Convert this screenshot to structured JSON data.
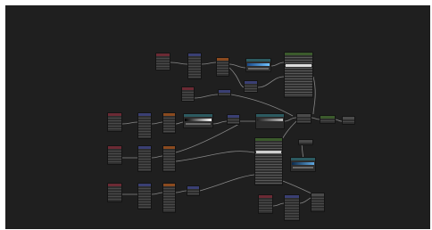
{
  "app": {
    "title": "",
    "description_visible": false
  },
  "colors": {
    "editor_bg": "#1f1f1f",
    "node_body": "#2e2e2e",
    "wire": "#9a9a9a",
    "header_red": "#6b2a34",
    "header_blue": "#3a3f73",
    "header_orange": "#8a4a1f",
    "header_teal": "#2c5a60",
    "header_green": "#3b5a2c",
    "header_gray": "#4a4a4a",
    "accent_blue": "#3b8fd6"
  },
  "nodes": [
    {
      "id": "n1",
      "header": "header_red"
    },
    {
      "id": "n2",
      "header": "header_blue"
    },
    {
      "id": "n3",
      "header": "header_orange"
    },
    {
      "id": "n4",
      "header": "header_teal"
    },
    {
      "id": "n5",
      "header": "header_blue"
    },
    {
      "id": "n6",
      "header": "header_green"
    },
    {
      "id": "n7",
      "header": "header_red"
    },
    {
      "id": "n8",
      "header": "header_blue"
    },
    {
      "id": "n9",
      "header": "header_red"
    },
    {
      "id": "n10",
      "header": "header_blue"
    },
    {
      "id": "n11",
      "header": "header_orange"
    },
    {
      "id": "n12",
      "header": "header_teal"
    },
    {
      "id": "n13",
      "header": "header_blue"
    },
    {
      "id": "n14",
      "header": "header_teal"
    },
    {
      "id": "n15",
      "header": "header_gray"
    },
    {
      "id": "n16",
      "header": "header_green"
    },
    {
      "id": "n17",
      "header": "header_gray"
    },
    {
      "id": "n18",
      "header": "header_red"
    },
    {
      "id": "n19",
      "header": "header_blue"
    },
    {
      "id": "n20",
      "header": "header_orange"
    },
    {
      "id": "n21",
      "header": "header_green"
    },
    {
      "id": "n22",
      "header": "header_gray"
    },
    {
      "id": "n23",
      "header": "header_teal"
    },
    {
      "id": "n24",
      "header": "header_red"
    },
    {
      "id": "n25",
      "header": "header_blue"
    },
    {
      "id": "n26",
      "header": "header_orange"
    },
    {
      "id": "n27",
      "header": "header_blue"
    },
    {
      "id": "n28",
      "header": "header_red"
    },
    {
      "id": "n29",
      "header": "header_blue"
    },
    {
      "id": "n30",
      "header": "header_gray"
    }
  ]
}
